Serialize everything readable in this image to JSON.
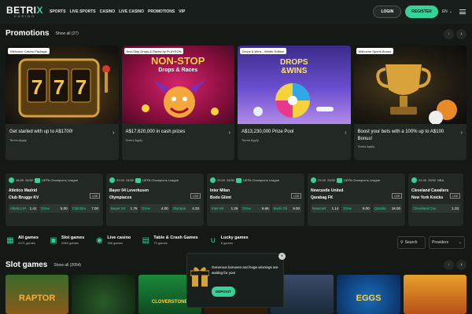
{
  "header": {
    "logo_text": "BETRI",
    "logo_x": "X",
    "logo_sub": "CASINO",
    "nav": [
      "SPORTS",
      "LIVE SPORTS",
      "CASINO",
      "LIVE CASINO",
      "PROMOTIONS",
      "VIP"
    ],
    "login_label": "LOGIN",
    "register_label": "REGISTER",
    "language": "EN",
    "icons": {
      "hamburger": "menu-icon",
      "lang_chevron": "chevron-down-icon"
    }
  },
  "promotions": {
    "title": "Promotions",
    "show_all": "Show all (27)",
    "cards": [
      {
        "tag": "Welcome Casino Package",
        "title": "Get started with up to A$1700!",
        "terms": "Terms Apply"
      },
      {
        "tag": "Non-Stop Drops & Races by PLAYSON",
        "title": "A$17,620,000 in cash prizes",
        "terms": "Terms Apply",
        "art_line1": "NON-STOP",
        "art_line2": "Drops & Races"
      },
      {
        "tag": "Drops & Wins - Winter Edition",
        "title": "A$13,230,000 Prize Pool",
        "terms": "Terms Apply",
        "art_line1": "DROPS",
        "art_line2": "&WINS"
      },
      {
        "tag": "Welcome Sports Bonus",
        "title": "Boost your bets with a 100% up to A$100 Bonus!",
        "terms": "Terms Apply"
      }
    ]
  },
  "matches": [
    {
      "time": "18:45",
      "date": "24/02",
      "league": "UEFA Champions League",
      "team1": "Atletico Madrid",
      "team2": "Club Brugge KV",
      "live": "LIVE",
      "odds": [
        {
          "n": "Atletico M",
          "v": "1.41"
        },
        {
          "n": "Drew",
          "v": "5.00"
        },
        {
          "n": "Club Bru",
          "v": "7.00"
        }
      ]
    },
    {
      "time": "21:00",
      "date": "24/02",
      "league": "UEFA Champions League",
      "team1": "Bayer 04 Leverkusen",
      "team2": "Olympiacos",
      "live": "LIVE",
      "odds": [
        {
          "n": "Bayer 04",
          "v": "1.76"
        },
        {
          "n": "Drew",
          "v": "4.00"
        },
        {
          "n": "Olympia",
          "v": "4.33"
        }
      ]
    },
    {
      "time": "21:00",
      "date": "24/02",
      "league": "UEFA Champions League",
      "team1": "Inter Milan",
      "team2": "Bodo Glimt",
      "live": "LIVE",
      "odds": [
        {
          "n": "Inter Mi",
          "v": "1.26"
        },
        {
          "n": "Drew",
          "v": "6.66"
        },
        {
          "n": "Bodo Gli",
          "v": "9.00"
        }
      ]
    },
    {
      "time": "21:00",
      "date": "24/02",
      "league": "UEFA Champions League",
      "team1": "Newcastle United",
      "team2": "Qarabag FK",
      "live": "LIVE",
      "odds": [
        {
          "n": "Newcast",
          "v": "1.14"
        },
        {
          "n": "Drew",
          "v": "9.00"
        },
        {
          "n": "Qarabа",
          "v": "16.00"
        }
      ]
    },
    {
      "time": "01:30",
      "date": "25/02",
      "league": "NBA",
      "team1": "Cleveland Cavaliers",
      "team2": "New York Knicks",
      "live": "LIVE",
      "odds": [
        {
          "n": "Cleveland Cav",
          "v": "1.33"
        }
      ]
    }
  ],
  "categories": [
    {
      "name": "All games",
      "count": "2471 games",
      "icon": "grid-icon"
    },
    {
      "name": "Slot games",
      "count": "2054 games",
      "icon": "slot-icon"
    },
    {
      "name": "Live casino",
      "count": "338 games",
      "icon": "live-icon"
    },
    {
      "name": "Table & Crash Games",
      "count": "73 games",
      "icon": "cards-icon"
    },
    {
      "name": "Lucky games",
      "count": "6 games",
      "icon": "horseshoe-icon"
    }
  ],
  "search_label": "Search",
  "providers_label": "Providers",
  "slots": {
    "title": "Slot games",
    "show_all": "Show all (2054)",
    "tile_texts": [
      "RAPTOR",
      "",
      "CLOVERSTONE",
      "",
      "",
      "EGGS",
      ""
    ]
  },
  "popup": {
    "text": "Generous bonuses and huge winnings are waiting for you!",
    "button": "DEPOSIT",
    "close": "×"
  },
  "colors": {
    "accent": "#34d399",
    "bg": "#141916",
    "card": "#222924"
  }
}
